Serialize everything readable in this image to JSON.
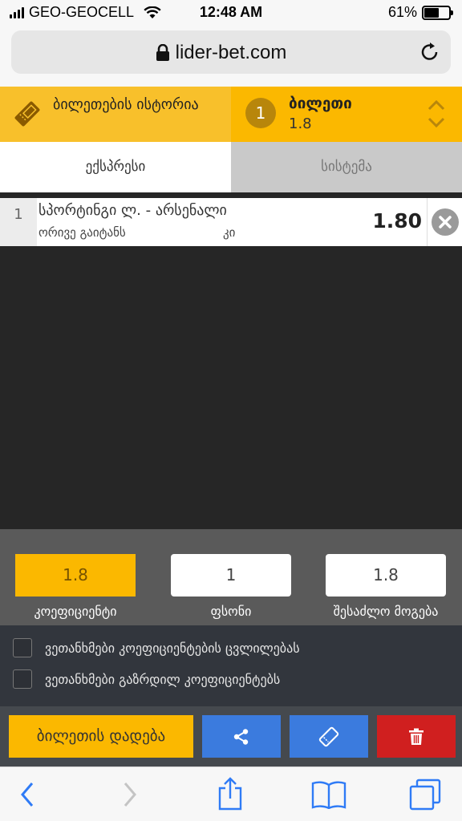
{
  "status_bar": {
    "carrier": "GEO-GEOCELL",
    "time": "12:48 AM",
    "battery": "61%",
    "battery_level": 0.61
  },
  "browser": {
    "url": "lider-bet.com"
  },
  "header": {
    "history_label": "ბილეთების ისტორია",
    "ticket_count": "1",
    "ticket_title": "ბილეთი",
    "ticket_odds": "1.8"
  },
  "tabs": [
    {
      "label": "ექსპრესი",
      "active": true
    },
    {
      "label": "სისტემა",
      "active": false
    }
  ],
  "bets": [
    {
      "num": "1",
      "match": "სპორტინგი ლ. - არსენალი",
      "market": "ორივე გაიტანს",
      "outcome": "კი",
      "odds": "1.80"
    }
  ],
  "summary": {
    "coefficient": {
      "value": "1.8",
      "label": "კოეფიციენტი"
    },
    "stake": {
      "value": "1",
      "label": "ფსონი"
    },
    "potential_win": {
      "value": "1.8",
      "label": "შესაძლო მოგება"
    }
  },
  "agreements": [
    {
      "label": "ვეთანხმები კოეფიციენტების ცვლილებას",
      "checked": false
    },
    {
      "label": "ვეთანხმები გაზრდილ კოეფიციენტებს",
      "checked": false
    }
  ],
  "actions": {
    "place_label": "ბილეთის დადება",
    "share_icon": "share-icon",
    "coupon_icon": "ticket-icon",
    "delete_icon": "trash-icon"
  },
  "colors": {
    "accent": "#fbb800",
    "action_blue": "#3b7bde",
    "danger": "#d01f1f"
  }
}
